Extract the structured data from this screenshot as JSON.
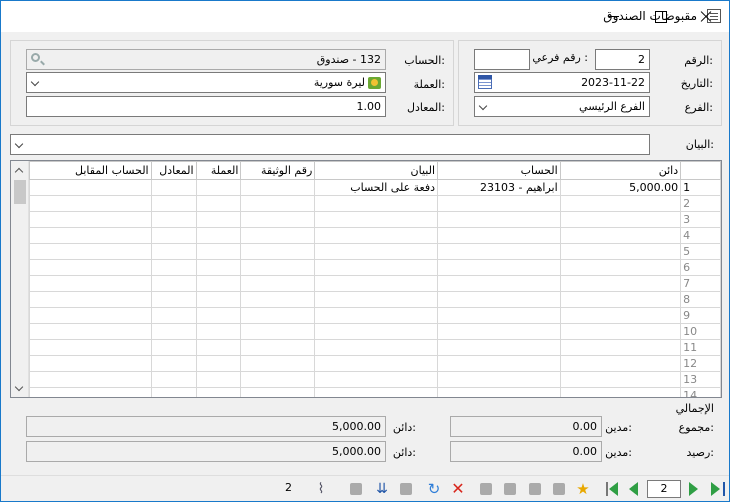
{
  "window": {
    "title": "مقبوضات الصندوق"
  },
  "right_group": {
    "number_label": "الرقم:",
    "number_value": "2",
    "sub_number_label": "رقم فرعي :",
    "sub_number_value": "",
    "date_label": "التاريخ:",
    "date_value": "2023-11-22",
    "branch_label": "الفرع:",
    "branch_value": "الفرع الرئيسي"
  },
  "left_group": {
    "account_label": "الحساب:",
    "account_value": "132 - صندوق",
    "currency_label": "العملة:",
    "currency_value": "ليرة سورية",
    "rate_label": "المعادل:",
    "rate_value": "1.00"
  },
  "statement": {
    "label": "البيان:",
    "value": ""
  },
  "grid": {
    "headers": {
      "credit": "دائن",
      "account": "الحساب",
      "statement": "البيان",
      "doc_number": "رقم الوثيقة",
      "currency": "العملة",
      "rate": "المعادل",
      "counter_account": "الحساب المقابل"
    },
    "rows": [
      {
        "n": "1",
        "credit": "5,000.00",
        "account": "23103 - ابراهيم",
        "statement": "دفعة على الحساب",
        "doc_number": "",
        "currency": "",
        "rate": "",
        "counter_account": ""
      },
      {
        "n": "2"
      },
      {
        "n": "3"
      },
      {
        "n": "4"
      },
      {
        "n": "5"
      },
      {
        "n": "6"
      },
      {
        "n": "7"
      },
      {
        "n": "8"
      },
      {
        "n": "9"
      },
      {
        "n": "10"
      },
      {
        "n": "11"
      },
      {
        "n": "12"
      },
      {
        "n": "13"
      },
      {
        "n": "14"
      }
    ]
  },
  "totals": {
    "section_label": "الإجمالي",
    "sum_label": "مجموع:",
    "balance_label": "رصيد:",
    "debit_label": "مدين:",
    "credit_label": "دائن:",
    "sum_debit": "0.00",
    "sum_credit": "5,000.00",
    "balance_debit": "0.00",
    "balance_credit": "5,000.00"
  },
  "statusbar": {
    "page_value": "2",
    "left_count": "2",
    "icons": [
      "last-record-icon",
      "next-record-icon",
      "prev-record-icon",
      "first-record-icon",
      "favorite-star-icon",
      "print-icon",
      "save-icon",
      "paste-icon",
      "copy-icon",
      "undo-icon",
      "delete-icon",
      "refresh-icon",
      "binoculars-icon",
      "import-icon",
      "settings-icon",
      "attachment-icon"
    ]
  }
}
